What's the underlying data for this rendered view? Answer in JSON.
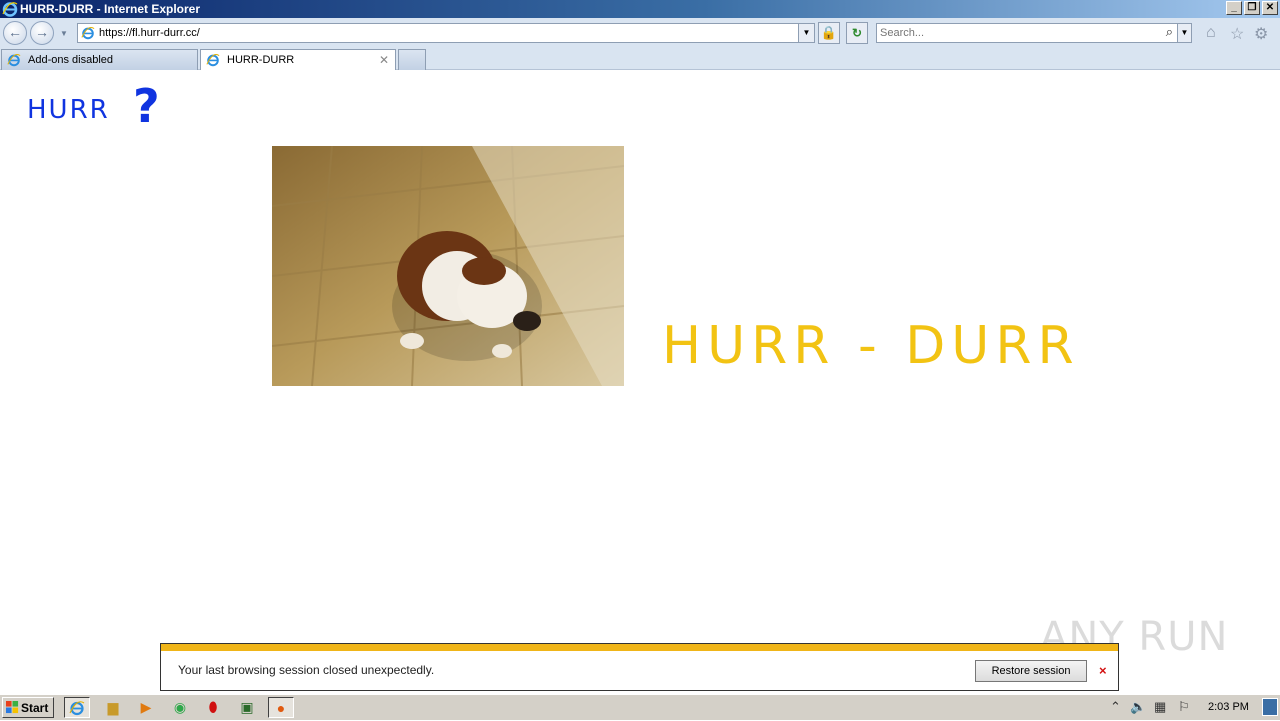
{
  "window": {
    "title": "HURR-DURR - Internet Explorer"
  },
  "nav": {
    "url": "https://fl.hurr-durr.cc/",
    "search_placeholder": "Search..."
  },
  "tabs": [
    {
      "label": "Add-ons disabled"
    },
    {
      "label": "HURR-DURR"
    }
  ],
  "page": {
    "logo_text": "HURR",
    "logo_mark": "?",
    "headline": "HURR - DURR"
  },
  "notification": {
    "message": "Your last browsing session closed unexpectedly.",
    "restore_label": "Restore session",
    "close_glyph": "×"
  },
  "watermark": "ANY RUN",
  "taskbar": {
    "start_label": "Start",
    "clock": "2:03 PM"
  },
  "colors": {
    "logo_blue": "#1034e0",
    "headline_yellow": "#f2c313",
    "notify_stripe": "#f0b518"
  }
}
